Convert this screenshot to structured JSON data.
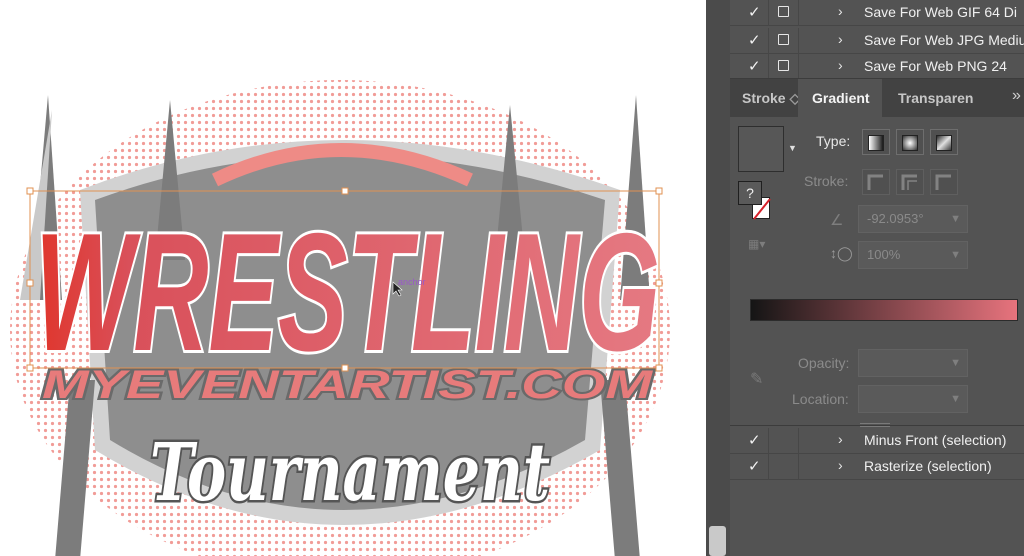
{
  "canvas": {
    "artwork": {
      "title_text": "WRESTLING",
      "url_text": "MYEVENTARTIST.COM",
      "subtitle_text": "Tournament",
      "anchor_label": "anchor"
    }
  },
  "actions_panel": {
    "items_top": [
      {
        "label": "Save For Web GIF 64 Di",
        "checked": true
      },
      {
        "label": "Save For Web JPG Mediu",
        "checked": true
      },
      {
        "label": "Save For Web PNG 24",
        "checked": true
      }
    ],
    "items_bottom": [
      {
        "label": "Minus Front (selection)",
        "checked": true
      },
      {
        "label": "Rasterize (selection)",
        "checked": true
      }
    ]
  },
  "gradient_panel": {
    "tabs": [
      {
        "label": "Stroke",
        "active": false
      },
      {
        "label": "Gradient",
        "active": true
      },
      {
        "label": "Transparen",
        "active": false
      }
    ],
    "type_label": "Type:",
    "stroke_label": "Stroke:",
    "angle_value": "-92.0953°",
    "aspect_value": "100%",
    "opacity_label": "Opacity:",
    "location_label": "Location:",
    "question_mark": "?",
    "gradient_colors": {
      "start": "#151515",
      "end": "#e7737d"
    }
  },
  "icons": [
    "checkmark-icon",
    "toggle-dialog-icon",
    "chevron-right-icon",
    "panel-menu-icon",
    "eyedropper-icon",
    "angle-icon",
    "aspect-ratio-icon",
    "reverse-gradient-icon"
  ]
}
